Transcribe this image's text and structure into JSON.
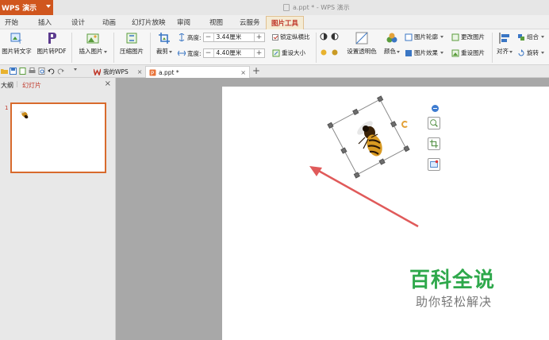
{
  "app": {
    "button_label": "WPS 演示",
    "window_title": "a.ppt * - WPS 演示"
  },
  "menu": {
    "tabs": [
      "开始",
      "插入",
      "设计",
      "动画",
      "幻灯片放映",
      "审阅",
      "视图",
      "云服务",
      "图片工具"
    ],
    "active_tab": "图片工具"
  },
  "ribbon": {
    "img_to_text": "图片转文字",
    "img_to_pdf": "图片转PDF",
    "insert_image": "插入图片",
    "compress_image": "压缩图片",
    "crop": "裁剪",
    "height_label": "高度:",
    "height_value": "3.44厘米",
    "width_label": "宽度:",
    "width_value": "4.40厘米",
    "lock_ratio": "锁定纵横比",
    "reset_size": "重设大小",
    "set_transparent": "设置透明色",
    "color": "颜色",
    "picture_outline": "图片轮廓",
    "picture_effects": "图片效果",
    "change_picture": "更改图片",
    "reset_picture": "重设图片",
    "align": "对齐",
    "group": "组合",
    "rotate": "旋转"
  },
  "doc_tabs": [
    {
      "label": "我的WPS",
      "active": false
    },
    {
      "label": "a.ppt *",
      "active": true
    }
  ],
  "left_panel": {
    "outline_tab": "大纲",
    "slides_tab": "幻灯片",
    "slide_number": "1"
  },
  "watermark": {
    "title": "百科全说",
    "subtitle": "助你轻松解决"
  },
  "colors": {
    "brand": "#d0561e",
    "active_tab": "#c0392b",
    "watermark": "#2ea84b",
    "arrow": "#e05a5a"
  }
}
